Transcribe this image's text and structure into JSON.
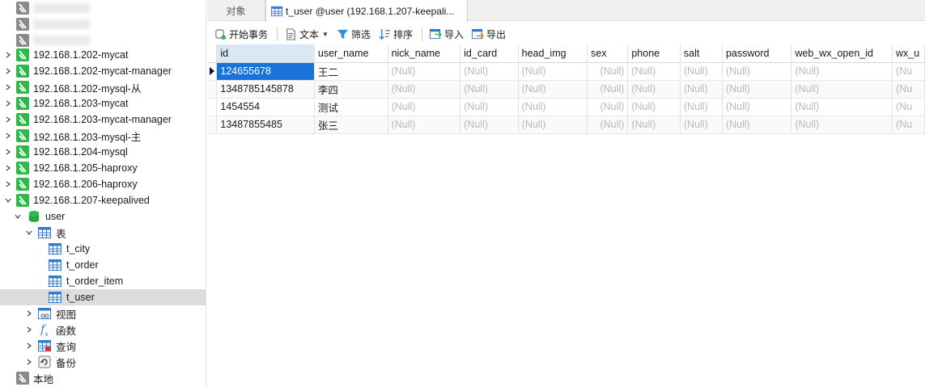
{
  "sidebar": {
    "connections": [
      {
        "label": "192.168.1.202-mycat"
      },
      {
        "label": "192.168.1.202-mycat-manager"
      },
      {
        "label": "192.168.1.202-mysql-从"
      },
      {
        "label": "192.168.1.203-mycat"
      },
      {
        "label": "192.168.1.203-mycat-manager"
      },
      {
        "label": "192.168.1.203-mysql-主"
      },
      {
        "label": "192.168.1.204-mysql"
      },
      {
        "label": "192.168.1.205-haproxy"
      },
      {
        "label": "192.168.1.206-haproxy"
      },
      {
        "label": "192.168.1.207-keepalived"
      }
    ],
    "database": "user",
    "tables_label": "表",
    "tables": [
      "t_city",
      "t_order",
      "t_order_item",
      "t_user"
    ],
    "views_label": "视图",
    "functions_label": "函数",
    "queries_label": "查询",
    "backups_label": "备份",
    "local_label": "本地"
  },
  "tabs": {
    "objects": "对象",
    "active": "t_user @user (192.168.1.207-keepali..."
  },
  "toolbar": {
    "begin_transaction": "开始事务",
    "text": "文本",
    "filter": "筛选",
    "sort": "排序",
    "import": "导入",
    "export": "导出"
  },
  "grid": {
    "columns": [
      "id",
      "user_name",
      "nick_name",
      "id_card",
      "head_img",
      "sex",
      "phone",
      "salt",
      "password",
      "web_wx_open_id",
      "wx_u"
    ],
    "rows": [
      [
        "124655678",
        "王二",
        "(Null)",
        "(Null)",
        "(Null)",
        "(Null)",
        "(Null)",
        "(Null)",
        "(Null)",
        "(Null)",
        "(Nu"
      ],
      [
        "1348785145878",
        "李四",
        "(Null)",
        "(Null)",
        "(Null)",
        "(Null)",
        "(Null)",
        "(Null)",
        "(Null)",
        "(Null)",
        "(Nu"
      ],
      [
        "1454554",
        "测试",
        "(Null)",
        "(Null)",
        "(Null)",
        "(Null)",
        "(Null)",
        "(Null)",
        "(Null)",
        "(Null)",
        "(Nu"
      ],
      [
        "13487855485",
        "张三",
        "(Null)",
        "(Null)",
        "(Null)",
        "(Null)",
        "(Null)",
        "(Null)",
        "(Null)",
        "(Null)",
        "(Nu"
      ]
    ]
  },
  "colors": {
    "connection_green": "#2db84a",
    "selection_blue": "#1a73d9",
    "null_gray": "#b8b8b8"
  }
}
